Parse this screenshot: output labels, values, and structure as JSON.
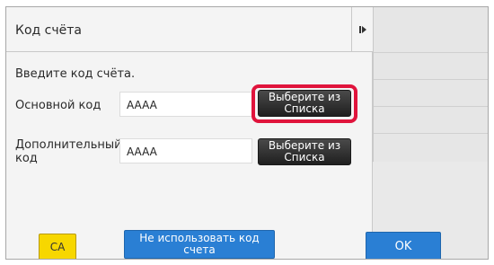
{
  "dialog": {
    "title": "Код счёта",
    "prompt": "Введите код счёта."
  },
  "fields": {
    "main": {
      "label": "Основной код",
      "value": "AAAA",
      "list_button": "Выберите из Списка"
    },
    "additional": {
      "label": "Дополнительный код",
      "value": "AAAA",
      "list_button": "Выберите из Списка"
    }
  },
  "buttons": {
    "ca": "CA",
    "no_account_code": "Не использовать код счета",
    "ok": "OK"
  },
  "colors": {
    "highlight": "#e0143c",
    "ca_button": "#f7d700",
    "primary_button": "#2a7fd4",
    "list_button": "#2b2b2b"
  },
  "icons": {
    "expand": "panel-expand-icon"
  }
}
